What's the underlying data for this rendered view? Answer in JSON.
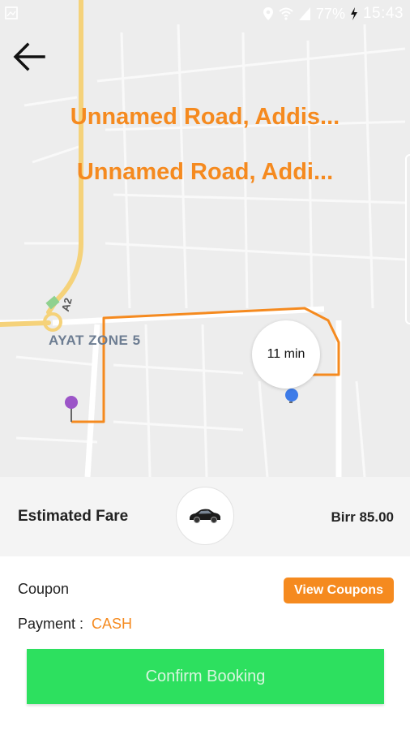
{
  "status_bar": {
    "battery": "77%",
    "time": "15:43"
  },
  "map": {
    "pickup_address": "Unnamed Road, Addis...",
    "dropoff_address": "Unnamed Road, Addi...",
    "zone_label": "AYAT ZONE 5",
    "road_label": "A2",
    "eta": "11 min"
  },
  "fare": {
    "label": "Estimated Fare",
    "amount": "Birr 85.00"
  },
  "booking": {
    "coupon_label": "Coupon",
    "view_coupons": "View Coupons",
    "payment_label": "Payment :",
    "payment_value": "CASH",
    "confirm": "Confirm Booking"
  },
  "colors": {
    "accent": "#f58a1f",
    "confirm": "#2de05f",
    "pickup_pin": "#9c55c8",
    "driver_dot": "#3d7be8"
  }
}
